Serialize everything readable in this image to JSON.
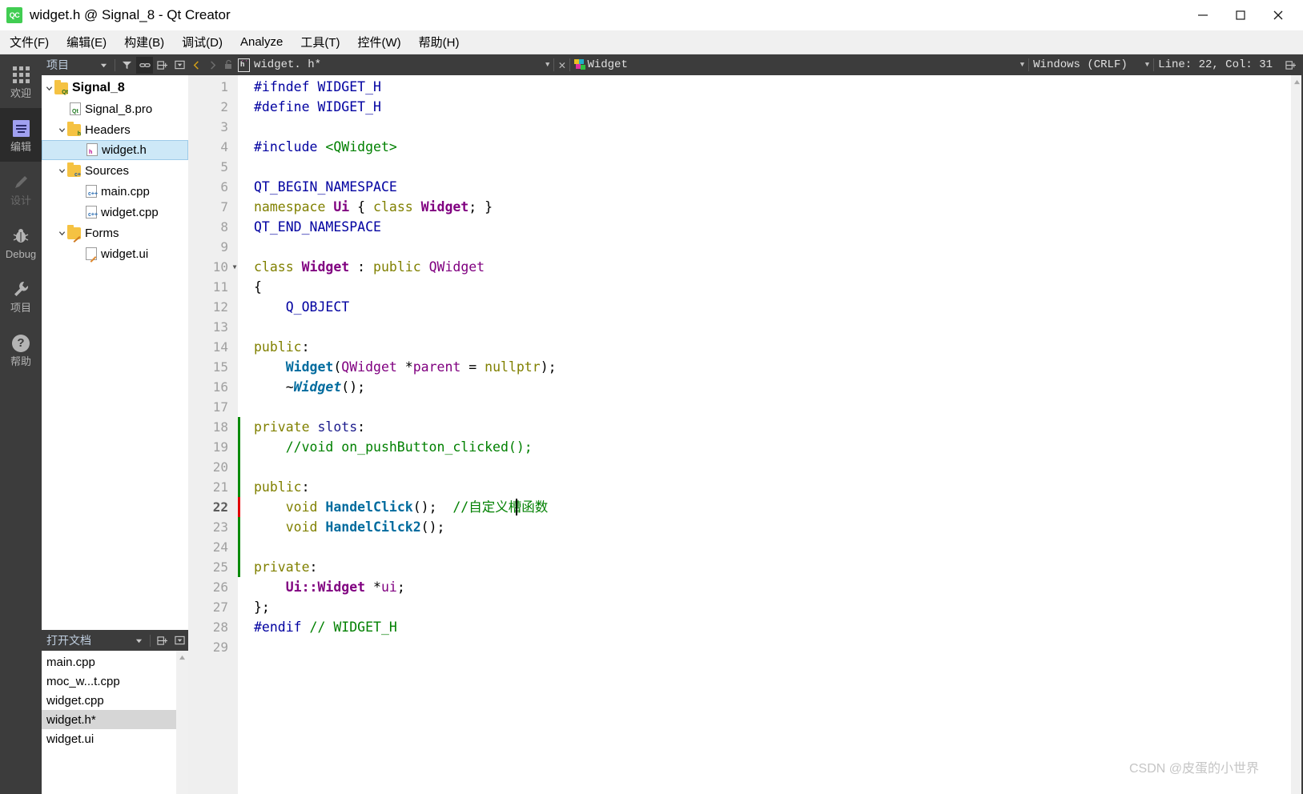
{
  "window": {
    "title": "widget.h @ Signal_8 - Qt Creator",
    "logo_text": "QC",
    "minimize": "—",
    "maximize": "☐",
    "close": "✕"
  },
  "menubar": {
    "items": [
      {
        "label": "文件(F)"
      },
      {
        "label": "编辑(E)"
      },
      {
        "label": "构建(B)"
      },
      {
        "label": "调试(D)"
      },
      {
        "label": "Analyze"
      },
      {
        "label": "工具(T)"
      },
      {
        "label": "控件(W)"
      },
      {
        "label": "帮助(H)"
      }
    ]
  },
  "modebar": {
    "items": [
      {
        "label": "欢迎",
        "icon": "grid-icon",
        "state": "normal"
      },
      {
        "label": "编辑",
        "icon": "edit-icon",
        "state": "active"
      },
      {
        "label": "设计",
        "icon": "design-pencil-icon",
        "state": "disabled"
      },
      {
        "label": "Debug",
        "icon": "bug-icon",
        "state": "normal"
      },
      {
        "label": "项目",
        "icon": "wrench-icon",
        "state": "normal"
      },
      {
        "label": "帮助",
        "icon": "question-icon",
        "state": "normal"
      }
    ]
  },
  "project_panel": {
    "title": "项目",
    "toolbar": [
      {
        "name": "filter-icon",
        "glyph": "▼"
      },
      {
        "name": "link-icon",
        "glyph": "⛓"
      },
      {
        "name": "split-icon",
        "glyph": "⊟"
      },
      {
        "name": "close-panel-icon",
        "glyph": "▭"
      }
    ],
    "tree": [
      {
        "label": "Signal_8",
        "indent": 0,
        "expanded": true,
        "icon": "folder-qt-icon",
        "bold": true,
        "selected": false
      },
      {
        "label": "Signal_8.pro",
        "indent": 1,
        "expanded": null,
        "icon": "file-pro-icon",
        "bold": false,
        "selected": false
      },
      {
        "label": "Headers",
        "indent": 1,
        "expanded": true,
        "icon": "folder-h-icon",
        "bold": false,
        "selected": false
      },
      {
        "label": "widget.h",
        "indent": 2,
        "expanded": null,
        "icon": "file-h-icon",
        "bold": false,
        "selected": true
      },
      {
        "label": "Sources",
        "indent": 1,
        "expanded": true,
        "icon": "folder-cpp-icon",
        "bold": false,
        "selected": false
      },
      {
        "label": "main.cpp",
        "indent": 2,
        "expanded": null,
        "icon": "file-cpp-icon",
        "bold": false,
        "selected": false
      },
      {
        "label": "widget.cpp",
        "indent": 2,
        "expanded": null,
        "icon": "file-cpp-icon",
        "bold": false,
        "selected": false
      },
      {
        "label": "Forms",
        "indent": 1,
        "expanded": true,
        "icon": "folder-ui-icon",
        "bold": false,
        "selected": false
      },
      {
        "label": "widget.ui",
        "indent": 2,
        "expanded": null,
        "icon": "file-ui-icon",
        "bold": false,
        "selected": false
      }
    ]
  },
  "open_documents": {
    "title": "打开文档",
    "toolbar": [
      {
        "name": "split-icon",
        "glyph": "⊟"
      },
      {
        "name": "close-panel-icon",
        "glyph": "▭"
      }
    ],
    "items": [
      {
        "label": "main.cpp",
        "selected": false
      },
      {
        "label": "moc_w...t.cpp",
        "selected": false
      },
      {
        "label": "widget.cpp",
        "selected": false
      },
      {
        "label": "widget.h*",
        "selected": true
      },
      {
        "label": "widget.ui",
        "selected": false
      }
    ]
  },
  "editor_toolbar": {
    "back_glyph": "❬",
    "forward_glyph": "❭",
    "lock_glyph": "🔓",
    "file_label": "widget. h*",
    "file_icon_letter": "h",
    "symbol_label": "Widget",
    "close_glyph": "✕",
    "encoding_label": "Windows (CRLF)",
    "cursor_label": "Line: 22, Col: 31",
    "split_glyph": "⊟"
  },
  "code": {
    "lines": [
      {
        "n": 1,
        "fold": "",
        "marker": "none",
        "current": false,
        "tokens": [
          {
            "t": "#ifndef ",
            "c": "s-pre"
          },
          {
            "t": "WIDGET_H",
            "c": "s-pre"
          }
        ]
      },
      {
        "n": 2,
        "fold": "",
        "marker": "none",
        "current": false,
        "tokens": [
          {
            "t": "#define ",
            "c": "s-pre"
          },
          {
            "t": "WIDGET_H",
            "c": "s-pre"
          }
        ]
      },
      {
        "n": 3,
        "fold": "",
        "marker": "none",
        "current": false,
        "tokens": []
      },
      {
        "n": 4,
        "fold": "",
        "marker": "none",
        "current": false,
        "tokens": [
          {
            "t": "#include ",
            "c": "s-pre"
          },
          {
            "t": "<QWidget>",
            "c": "s-str"
          }
        ]
      },
      {
        "n": 5,
        "fold": "",
        "marker": "none",
        "current": false,
        "tokens": []
      },
      {
        "n": 6,
        "fold": "",
        "marker": "none",
        "current": false,
        "tokens": [
          {
            "t": "QT_BEGIN_NAMESPACE",
            "c": "s-macro"
          }
        ]
      },
      {
        "n": 7,
        "fold": "",
        "marker": "none",
        "current": false,
        "tokens": [
          {
            "t": "namespace ",
            "c": "s-kw"
          },
          {
            "t": "Ui",
            "c": "s-type"
          },
          {
            "t": " { ",
            "c": "s-plain"
          },
          {
            "t": "class ",
            "c": "s-kw"
          },
          {
            "t": "Widget",
            "c": "s-type"
          },
          {
            "t": "; }",
            "c": "s-plain"
          }
        ]
      },
      {
        "n": 8,
        "fold": "",
        "marker": "none",
        "current": false,
        "tokens": [
          {
            "t": "QT_END_NAMESPACE",
            "c": "s-macro"
          }
        ]
      },
      {
        "n": 9,
        "fold": "",
        "marker": "none",
        "current": false,
        "tokens": []
      },
      {
        "n": 10,
        "fold": "▼",
        "marker": "none",
        "current": false,
        "tokens": [
          {
            "t": "class ",
            "c": "s-kw"
          },
          {
            "t": "Widget",
            "c": "s-type"
          },
          {
            "t": " : ",
            "c": "s-plain"
          },
          {
            "t": "public ",
            "c": "s-kw"
          },
          {
            "t": "QWidget",
            "c": "s-qt"
          }
        ]
      },
      {
        "n": 11,
        "fold": "",
        "marker": "none",
        "current": false,
        "tokens": [
          {
            "t": "{",
            "c": "s-plain"
          }
        ]
      },
      {
        "n": 12,
        "fold": "",
        "marker": "none",
        "current": false,
        "tokens": [
          {
            "t": "    Q_OBJECT",
            "c": "s-macro"
          }
        ]
      },
      {
        "n": 13,
        "fold": "",
        "marker": "none",
        "current": false,
        "tokens": []
      },
      {
        "n": 14,
        "fold": "",
        "marker": "none",
        "current": false,
        "tokens": [
          {
            "t": "public",
            "c": "s-kw"
          },
          {
            "t": ":",
            "c": "s-plain"
          }
        ]
      },
      {
        "n": 15,
        "fold": "",
        "marker": "none",
        "current": false,
        "tokens": [
          {
            "t": "    ",
            "c": "s-plain"
          },
          {
            "t": "Widget",
            "c": "s-fn"
          },
          {
            "t": "(",
            "c": "s-plain"
          },
          {
            "t": "QWidget",
            "c": "s-qt"
          },
          {
            "t": " *",
            "c": "s-plain"
          },
          {
            "t": "parent",
            "c": "s-var"
          },
          {
            "t": " = ",
            "c": "s-plain"
          },
          {
            "t": "nullptr",
            "c": "s-kw"
          },
          {
            "t": ");",
            "c": "s-plain"
          }
        ]
      },
      {
        "n": 16,
        "fold": "",
        "marker": "none",
        "current": false,
        "tokens": [
          {
            "t": "    ~",
            "c": "s-plain"
          },
          {
            "t": "Widget",
            "c": "s-dtor"
          },
          {
            "t": "();",
            "c": "s-plain"
          }
        ]
      },
      {
        "n": 17,
        "fold": "",
        "marker": "none",
        "current": false,
        "tokens": []
      },
      {
        "n": 18,
        "fold": "",
        "marker": "green",
        "current": false,
        "tokens": [
          {
            "t": "private ",
            "c": "s-kw"
          },
          {
            "t": "slots",
            "c": "s-slot"
          },
          {
            "t": ":",
            "c": "s-plain"
          }
        ]
      },
      {
        "n": 19,
        "fold": "",
        "marker": "green",
        "current": false,
        "tokens": [
          {
            "t": "    //void on_pushButton_clicked();",
            "c": "s-cmt"
          }
        ]
      },
      {
        "n": 20,
        "fold": "",
        "marker": "green",
        "current": false,
        "tokens": []
      },
      {
        "n": 21,
        "fold": "",
        "marker": "green",
        "current": false,
        "tokens": [
          {
            "t": "public",
            "c": "s-kw"
          },
          {
            "t": ":",
            "c": "s-plain"
          }
        ]
      },
      {
        "n": 22,
        "fold": "",
        "marker": "red",
        "current": true,
        "tokens": [
          {
            "t": "    ",
            "c": "s-plain"
          },
          {
            "t": "void ",
            "c": "s-kw"
          },
          {
            "t": "HandelClick",
            "c": "s-fn"
          },
          {
            "t": "();  ",
            "c": "s-plain"
          },
          {
            "t": "//自定义槽函数",
            "c": "s-cmt"
          }
        ]
      },
      {
        "n": 23,
        "fold": "",
        "marker": "green",
        "current": false,
        "tokens": [
          {
            "t": "    ",
            "c": "s-plain"
          },
          {
            "t": "void ",
            "c": "s-kw"
          },
          {
            "t": "HandelCilck2",
            "c": "s-fn"
          },
          {
            "t": "();",
            "c": "s-plain"
          }
        ]
      },
      {
        "n": 24,
        "fold": "",
        "marker": "green",
        "current": false,
        "tokens": []
      },
      {
        "n": 25,
        "fold": "",
        "marker": "green",
        "current": false,
        "tokens": [
          {
            "t": "private",
            "c": "s-kw"
          },
          {
            "t": ":",
            "c": "s-plain"
          }
        ]
      },
      {
        "n": 26,
        "fold": "",
        "marker": "none",
        "current": false,
        "tokens": [
          {
            "t": "    ",
            "c": "s-plain"
          },
          {
            "t": "Ui::Widget",
            "c": "s-type"
          },
          {
            "t": " *",
            "c": "s-plain"
          },
          {
            "t": "ui",
            "c": "s-var"
          },
          {
            "t": ";",
            "c": "s-plain"
          }
        ]
      },
      {
        "n": 27,
        "fold": "",
        "marker": "none",
        "current": false,
        "tokens": [
          {
            "t": "};",
            "c": "s-plain"
          }
        ]
      },
      {
        "n": 28,
        "fold": "",
        "marker": "none",
        "current": false,
        "tokens": [
          {
            "t": "#endif ",
            "c": "s-pre"
          },
          {
            "t": "// WIDGET_H",
            "c": "s-cmt"
          }
        ]
      },
      {
        "n": 29,
        "fold": "",
        "marker": "none",
        "current": false,
        "tokens": []
      }
    ]
  },
  "scrollbars": {
    "up_glyph": "▲",
    "down_glyph": "▼"
  },
  "watermark": {
    "text": "CSDN @皮蛋的小世界"
  },
  "colors": {
    "accent_green": "#41cd52",
    "dark_chrome": "#3c3c3c",
    "selection_blue": "#cde8f7",
    "change_green": "#0a8a0a",
    "change_red": "#e00000"
  }
}
